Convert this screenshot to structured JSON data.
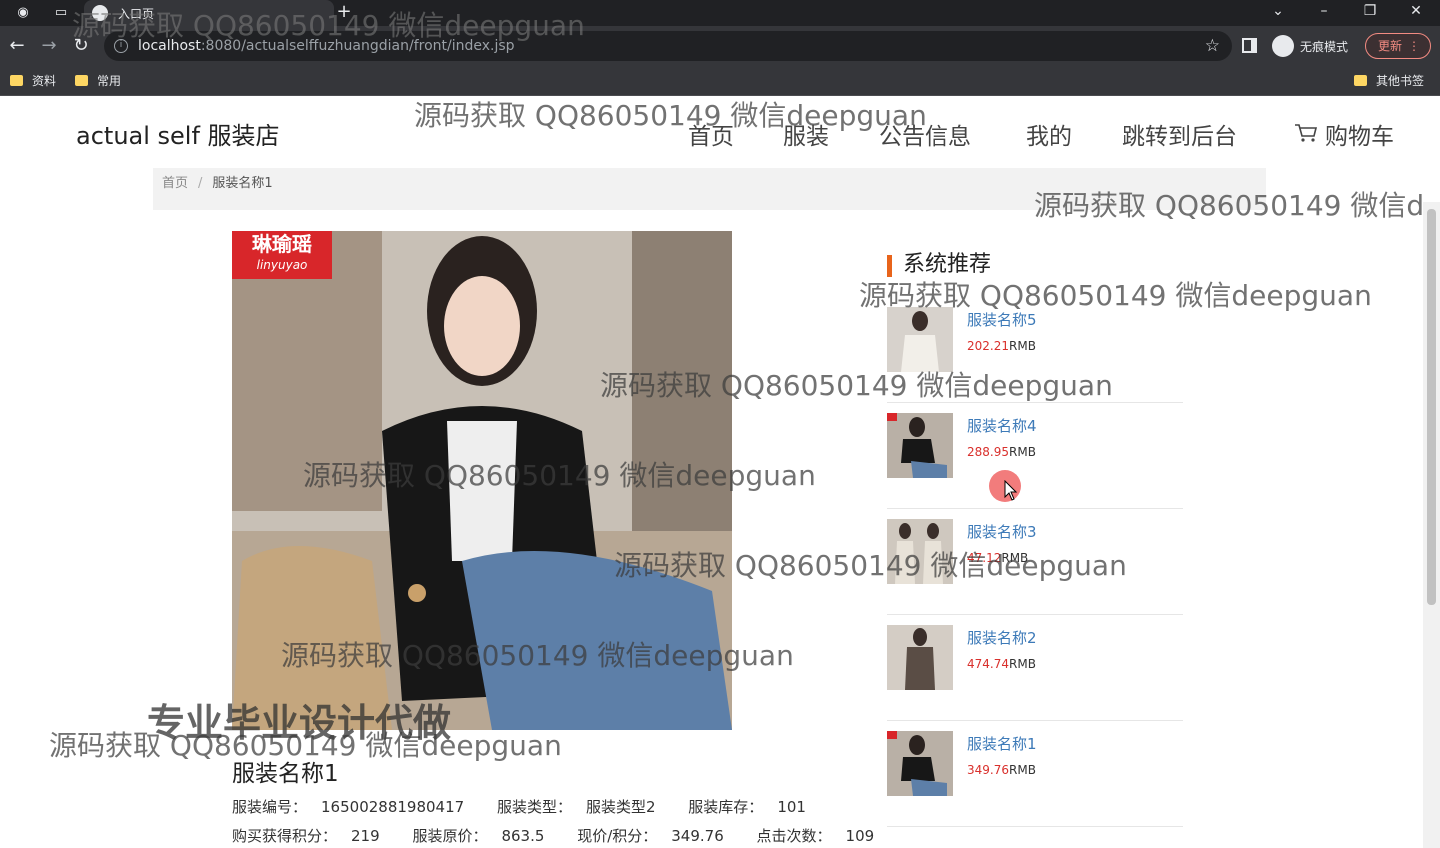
{
  "browser": {
    "tab_title": "入口页",
    "new_tab": "+",
    "url_host": "localhost",
    "url_rest": ":8080/actualselffuzhuangdian/front/index.jsp",
    "incognito_label": "无痕模式",
    "update_label": "更新",
    "bookmarks": [
      "资料",
      "常用"
    ],
    "other_bookmarks": "其他书签"
  },
  "header": {
    "brand": "actual self 服装店",
    "menu": [
      "首页",
      "服装",
      "公告信息",
      "我的",
      "跳转到后台",
      "购物车"
    ]
  },
  "breadcrumb": {
    "home": "首页",
    "sep": "/",
    "current": "服装名称1"
  },
  "product": {
    "brand_tag_cn": "琳瑜瑶",
    "brand_tag_en": "linyuyao",
    "name": "服装名称1",
    "specs_line1": [
      {
        "label": "服装编号：",
        "value": "165002881980417"
      },
      {
        "label": "服装类型：",
        "value": "服装类型2"
      },
      {
        "label": "服装库存：",
        "value": "101"
      }
    ],
    "specs_line2": [
      {
        "label": "购买获得积分：",
        "value": "219"
      },
      {
        "label": "服装原价：",
        "value": "863.5"
      },
      {
        "label": "现价/积分：",
        "value": "349.76"
      },
      {
        "label": "点击次数：",
        "value": "109"
      }
    ]
  },
  "recommend": {
    "title": "系统推荐",
    "currency": "RMB",
    "items": [
      {
        "name": "服装名称5",
        "price": "202.21"
      },
      {
        "name": "服装名称4",
        "price": "288.95"
      },
      {
        "name": "服装名称3",
        "price": "47.12"
      },
      {
        "name": "服装名称2",
        "price": "474.74"
      },
      {
        "name": "服装名称1",
        "price": "349.76"
      }
    ]
  },
  "watermark": {
    "text": "源码获取 QQ86050149 微信deepguan",
    "text_cut": "源码获取 QQ86050149 微信d",
    "bold": "专业毕业设计代做"
  }
}
